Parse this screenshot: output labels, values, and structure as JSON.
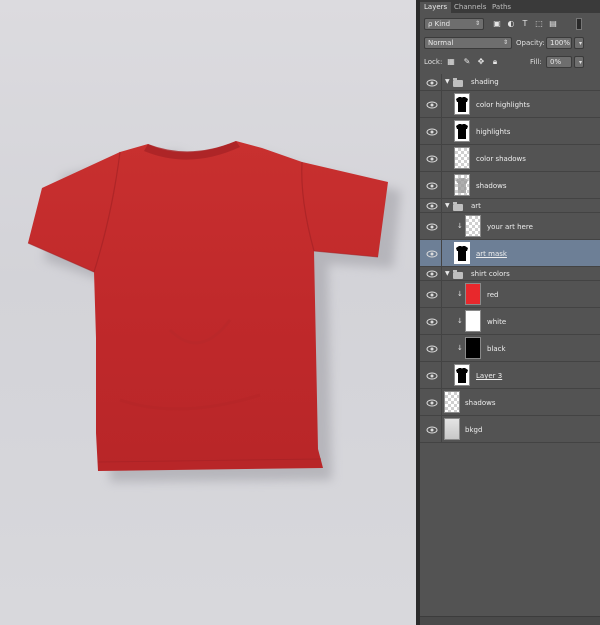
{
  "tabs": [
    {
      "label": "Layers",
      "active": true
    },
    {
      "label": "Channels",
      "active": false
    },
    {
      "label": "Paths",
      "active": false
    }
  ],
  "filter": {
    "kind_label": "ρ Kind"
  },
  "blend": {
    "mode": "Normal",
    "opacity_label": "Opacity:",
    "opacity_value": "100%"
  },
  "lock": {
    "label": "Lock:",
    "fill_label": "Fill:",
    "fill_value": "0%"
  },
  "layers": [
    {
      "name": "shading",
      "type": "group"
    },
    {
      "name": "color highlights",
      "type": "layer",
      "thumb": "shirt-black"
    },
    {
      "name": "highlights",
      "type": "layer",
      "thumb": "shirt-black"
    },
    {
      "name": "color shadows",
      "type": "layer",
      "thumb": "transparent"
    },
    {
      "name": "shadows",
      "type": "layer",
      "thumb": "shirt-gray"
    },
    {
      "name": "art",
      "type": "group"
    },
    {
      "name": "your art here",
      "type": "layer",
      "thumb": "transparent",
      "clipped": true
    },
    {
      "name": "art mask",
      "type": "layer",
      "thumb": "shirt-black",
      "selected": true
    },
    {
      "name": "shirt colors",
      "type": "group"
    },
    {
      "name": "red",
      "type": "layer",
      "thumb": "red",
      "clipped": true
    },
    {
      "name": "white",
      "type": "layer",
      "thumb": "white",
      "clipped": true
    },
    {
      "name": "black",
      "type": "layer",
      "thumb": "black",
      "clipped": true
    },
    {
      "name": "Layer 3",
      "type": "layer",
      "thumb": "shirt-black"
    },
    {
      "name": "shadows",
      "type": "layer",
      "thumb": "transparent"
    },
    {
      "name": "bkgd",
      "type": "layer",
      "thumb": "gray"
    }
  ],
  "colors": {
    "shirt": "#c42b2d",
    "selected_row": "#6d7f96",
    "panel": "#535353",
    "red_swatch": "#e8282c"
  }
}
